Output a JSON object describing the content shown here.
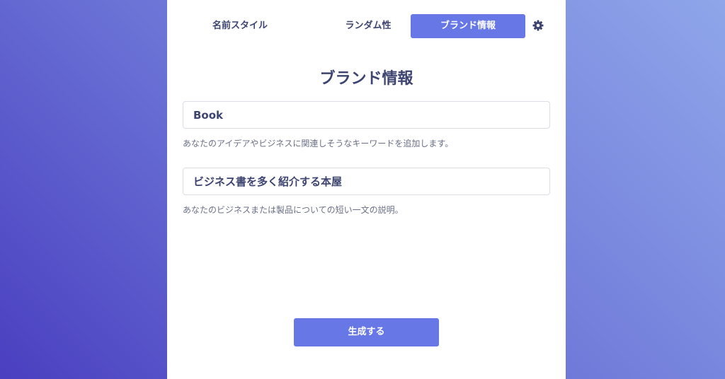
{
  "tabs": [
    {
      "label": "名前スタイル",
      "active": false
    },
    {
      "label": "ランダム性",
      "active": false
    },
    {
      "label": "ブランド情報",
      "active": true
    }
  ],
  "settings_icon": "gear-icon",
  "title": "ブランド情報",
  "keywords": {
    "value": "Book",
    "help": "あなたのアイデアやビジネスに関連しそうなキーワードを追加します。"
  },
  "description": {
    "value": "ビジネス書を多く紹介する本屋",
    "help": "あなたのビジネスまたは製品についての短い一文の説明。"
  },
  "generate_label": "生成する",
  "colors": {
    "accent": "#6777e6",
    "text": "#3d4470",
    "muted": "#6a6f86"
  }
}
